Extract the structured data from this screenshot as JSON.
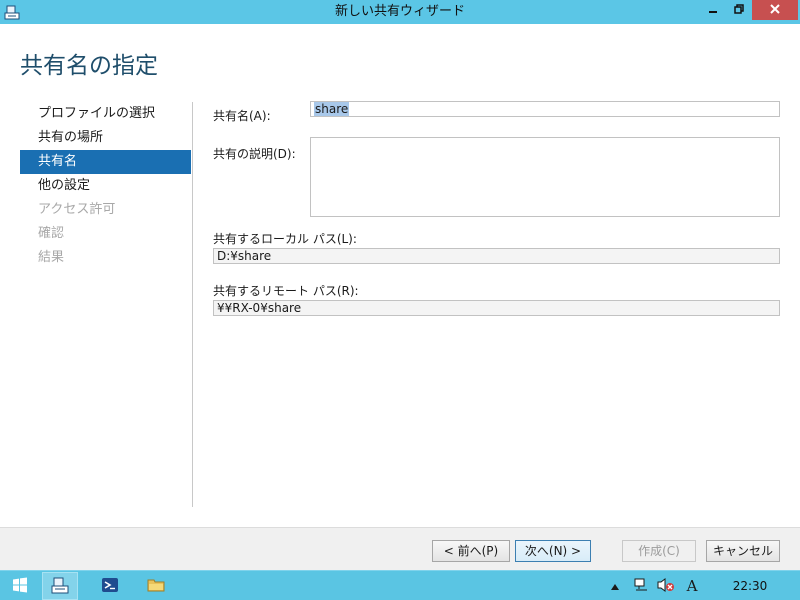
{
  "window": {
    "title": "新しい共有ウィザード",
    "icon": "share-wizard-icon"
  },
  "page": {
    "title": "共有名の指定"
  },
  "steps": [
    {
      "label": "プロファイルの選択",
      "state": "done"
    },
    {
      "label": "共有の場所",
      "state": "done"
    },
    {
      "label": "共有名",
      "state": "active"
    },
    {
      "label": "他の設定",
      "state": "enabled"
    },
    {
      "label": "アクセス許可",
      "state": "disabled"
    },
    {
      "label": "確認",
      "state": "disabled"
    },
    {
      "label": "結果",
      "state": "disabled"
    }
  ],
  "form": {
    "share_name_label": "共有名(A):",
    "share_name_value": "share",
    "description_label": "共有の説明(D):",
    "description_value": "",
    "local_path_label": "共有するローカル パス(L):",
    "local_path_value": "D:¥share",
    "remote_path_label": "共有するリモート パス(R):",
    "remote_path_value": "¥¥RX-0¥share"
  },
  "buttons": {
    "back": "< 前へ(P)",
    "next": "次へ(N) >",
    "create": "作成(C)",
    "cancel": "キャンセル"
  },
  "taskbar": {
    "clock": "22:30",
    "ime": "A"
  },
  "colors": {
    "accent": "#1a6fb2",
    "titlebar": "#5bc6e6",
    "close": "#c75050",
    "taskbar": "#5ac5e3"
  }
}
